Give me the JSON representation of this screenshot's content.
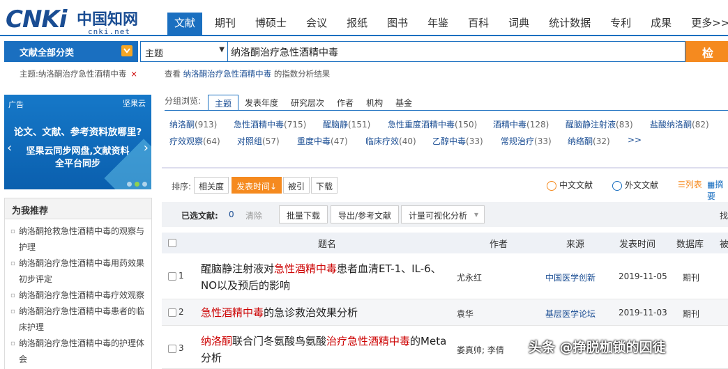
{
  "logo": {
    "brand": "CNKi",
    "cn": "中国知网",
    "url": "cnki.net"
  },
  "nav": [
    "文献",
    "期刊",
    "博硕士",
    "会议",
    "报纸",
    "图书",
    "年鉴",
    "百科",
    "词典",
    "统计数据",
    "专利",
    "成果",
    "更多>>"
  ],
  "search": {
    "category": "文献全部分类",
    "field": "主题",
    "query": "纳洛酮治疗急性酒精中毒",
    "button": "检 索"
  },
  "crumb": {
    "filter": "主题:纳洛酮治疗急性酒精中毒",
    "close": "×",
    "view_prefix": "查看",
    "view_term": "纳洛酮治疗急性酒精中毒",
    "view_suffix": "的指数分析结果"
  },
  "ad": {
    "tag": "广告",
    "brand": "坚果云",
    "line1": "论文、文献、参考资料放哪里?",
    "line2": "坚果云同步网盘,文献资料",
    "line3": "全平台同步"
  },
  "recommend": {
    "title": "为我推荐",
    "items": [
      "纳洛酮抢救急性酒精中毒的观察与护理",
      "纳洛酮治疗急性酒精中毒用药效果初步评定",
      "纳洛酮治疗急性酒精中毒疗效观察",
      "纳洛酮治疗急性酒精中毒患者的临床护理",
      "纳洛酮治疗急性酒精中毒的护理体会"
    ]
  },
  "group": {
    "label": "分组浏览:",
    "tabs": [
      "主题",
      "发表年度",
      "研究层次",
      "作者",
      "机构",
      "基金"
    ],
    "keywords_row1": [
      {
        "k": "纳洛酮",
        "c": "(913)"
      },
      {
        "k": "急性酒精中毒",
        "c": "(715)"
      },
      {
        "k": "醒脑静",
        "c": "(151)"
      },
      {
        "k": "急性重度酒精中毒",
        "c": "(150)"
      },
      {
        "k": "酒精中毒",
        "c": "(128)"
      },
      {
        "k": "醒脑静注射液",
        "c": "(83)"
      },
      {
        "k": "盐酸纳洛酮",
        "c": "(82)"
      }
    ],
    "keywords_row2": [
      {
        "k": "疗效观察",
        "c": "(64)"
      },
      {
        "k": "对照组",
        "c": "(57)"
      },
      {
        "k": "重度中毒",
        "c": "(47)"
      },
      {
        "k": "临床疗效",
        "c": "(40)"
      },
      {
        "k": "乙醇中毒",
        "c": "(33)"
      },
      {
        "k": "常规治疗",
        "c": "(33)"
      },
      {
        "k": "纳络酮",
        "c": "(32)"
      },
      {
        "k": ">>",
        "c": ""
      }
    ]
  },
  "toolbar": {
    "sort_label": "排序:",
    "sorts": [
      "相关度",
      "发表时间↓",
      "被引",
      "下载"
    ],
    "zh": "中文文献",
    "en": "外文文献",
    "list": "列表",
    "abstract": "摘要"
  },
  "selected": {
    "label": "已选文献:",
    "count": "0",
    "clear": "清除",
    "batch": "批量下载",
    "export": "导出/参考文献",
    "visual": "计量可视化分析",
    "visual_arrow": "▾",
    "right": "找"
  },
  "table": {
    "headers": [
      "题名",
      "作者",
      "来源",
      "发表时间",
      "数据库",
      "被"
    ],
    "rows": [
      {
        "num": "1",
        "t_pre": "醒脑静注射液对",
        "t_red": "急性酒精中毒",
        "t_post": "患者血清ET-1、IL-6、NO以及预后的影响",
        "author": "尤永红",
        "source": "中国医学创新",
        "date": "2019-11-05",
        "db": "期刊"
      },
      {
        "num": "2",
        "t_pre": "",
        "t_red": "急性酒精中毒",
        "t_post": "的急诊救治效果分析",
        "author": "袁华",
        "source": "基层医学论坛",
        "date": "2019-11-03",
        "db": "期刊"
      },
      {
        "num": "3",
        "t_pre": "",
        "t_red": "纳洛酮",
        "t_post": "联合门冬氨酸鸟氨酸",
        "t_red2": "治疗急性酒精中毒",
        "t_post2": "的Meta分析",
        "author": "娄真帅; 李倩",
        "source": "",
        "date": "",
        "db": ""
      }
    ]
  },
  "watermark": "头条 @挣脱枷锁的囚徒",
  "colors": {
    "primary": "#1a6fc0",
    "accent": "#f58a1f",
    "highlight": "#c00000"
  }
}
